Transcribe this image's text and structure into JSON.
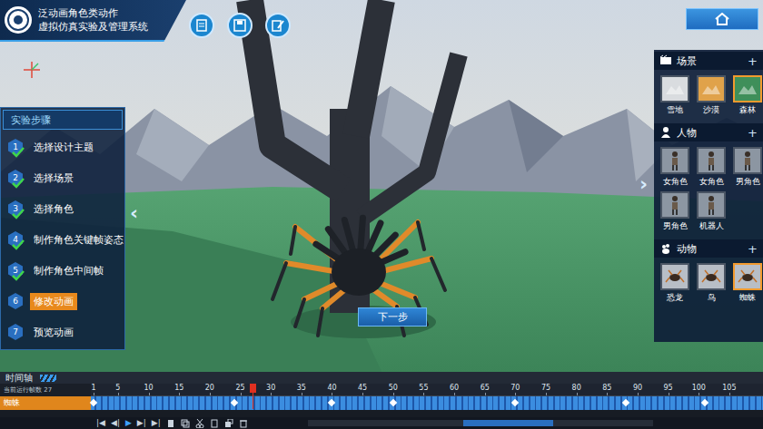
{
  "header": {
    "title_lines": [
      "泛动画角色类动作",
      "虚拟仿真实验及管理系统"
    ]
  },
  "nav": {
    "prev": "‹",
    "next": "›"
  },
  "steps": {
    "title": "实验步骤",
    "items": [
      {
        "number": "1",
        "label": "选择设计主题",
        "done": true,
        "selected": false
      },
      {
        "number": "2",
        "label": "选择场景",
        "done": true,
        "selected": false
      },
      {
        "number": "3",
        "label": "选择角色",
        "done": true,
        "selected": false
      },
      {
        "number": "4",
        "label": "制作角色关键帧姿态",
        "done": true,
        "selected": false
      },
      {
        "number": "5",
        "label": "制作角色中间帧",
        "done": true,
        "selected": false
      },
      {
        "number": "6",
        "label": "修改动画",
        "done": false,
        "selected": true
      },
      {
        "number": "7",
        "label": "预览动画",
        "done": false,
        "selected": false
      }
    ]
  },
  "library": {
    "sections": [
      {
        "title": "场景",
        "add": "+",
        "items": [
          {
            "label": "雪地",
            "selected": false
          },
          {
            "label": "沙漠",
            "selected": false
          },
          {
            "label": "森林",
            "selected": true
          }
        ]
      },
      {
        "title": "人物",
        "add": "+",
        "items": [
          {
            "label": "女角色",
            "selected": false
          },
          {
            "label": "女角色",
            "selected": false
          },
          {
            "label": "男角色",
            "selected": false
          },
          {
            "label": "男角色",
            "selected": false
          },
          {
            "label": "机器人",
            "selected": false
          }
        ]
      },
      {
        "title": "动物",
        "add": "+",
        "items": [
          {
            "label": "恐龙",
            "selected": false
          },
          {
            "label": "鸟",
            "selected": false
          },
          {
            "label": "蜘蛛",
            "selected": true
          }
        ]
      }
    ]
  },
  "next_button": "下一步",
  "timeline": {
    "title": "时间轴",
    "current_frame_label": "当前运行帧数 27",
    "ticks": [
      "1",
      "5",
      "10",
      "15",
      "20",
      "25",
      "30",
      "35",
      "40",
      "45",
      "50",
      "55",
      "60",
      "65",
      "70",
      "75",
      "80",
      "85",
      "90",
      "95",
      "100",
      "105"
    ],
    "playhead": 27,
    "tracks": [
      {
        "label": "蜘蛛",
        "keyframes": [
          1,
          24,
          40,
          50,
          70,
          88,
          101
        ]
      }
    ],
    "scroll": {
      "position": 0.45,
      "level": 0.26
    }
  },
  "controls": [
    "|◀",
    "◀|",
    "▶",
    "▶|",
    "▶|"
  ]
}
